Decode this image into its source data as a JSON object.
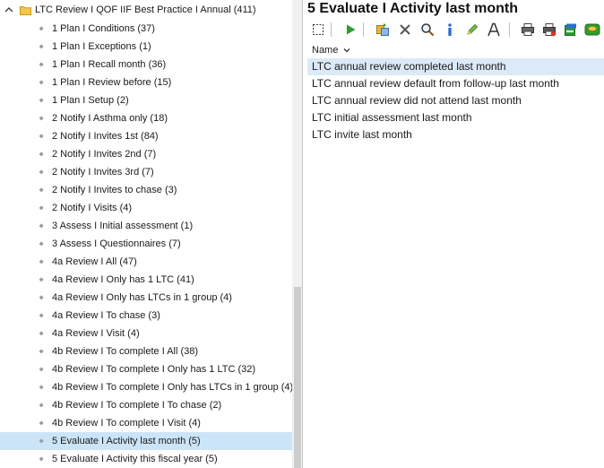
{
  "tree": {
    "root_label": "LTC Review I QOF IIF Best Practice I Annual (411)",
    "items": [
      {
        "label": "1 Plan I Conditions (37)"
      },
      {
        "label": "1 Plan I Exceptions (1)"
      },
      {
        "label": "1 Plan I Recall month (36)"
      },
      {
        "label": "1 Plan I Review before (15)"
      },
      {
        "label": "1 Plan I Setup (2)"
      },
      {
        "label": "2 Notify I Asthma only (18)"
      },
      {
        "label": "2 Notify I Invites 1st (84)"
      },
      {
        "label": "2 Notify I Invites 2nd (7)"
      },
      {
        "label": "2 Notify I Invites 3rd (7)"
      },
      {
        "label": "2 Notify I Invites to chase (3)"
      },
      {
        "label": "2 Notify I Visits (4)"
      },
      {
        "label": "3 Assess I Initial assessment (1)"
      },
      {
        "label": "3 Assess I Questionnaires (7)"
      },
      {
        "label": "4a Review I All (47)"
      },
      {
        "label": "4a Review I Only has 1 LTC (41)"
      },
      {
        "label": "4a Review I Only has LTCs in 1 group (4)"
      },
      {
        "label": "4a Review I To chase (3)"
      },
      {
        "label": "4a Review I Visit (4)"
      },
      {
        "label": "4b Review I To complete I All (38)"
      },
      {
        "label": "4b Review I To complete I Only has 1 LTC (32)"
      },
      {
        "label": "4b Review I To complete I Only has LTCs in 1 group (4)"
      },
      {
        "label": "4b Review I To complete I To chase (2)"
      },
      {
        "label": "4b Review I To complete I Visit (4)"
      },
      {
        "label": "5 Evaluate I Activity last month (5)"
      },
      {
        "label": "5 Evaluate I Activity this fiscal year (5)"
      }
    ],
    "selected_index": 23
  },
  "main": {
    "title": "5 Evaluate I Activity last month",
    "column_header": "Name",
    "rows": [
      {
        "name": "LTC annual review completed last month"
      },
      {
        "name": "LTC annual review default from follow-up last month"
      },
      {
        "name": "LTC annual review did not attend last month"
      },
      {
        "name": "LTC initial assessment last month"
      },
      {
        "name": "LTC invite last month"
      }
    ],
    "selected_row": 0
  },
  "toolbar": {
    "buttons": [
      "select-icon",
      "run-icon",
      "copy-icon",
      "delete-icon",
      "search-icon",
      "info-icon",
      "edit-icon",
      "font-icon",
      "print-icon",
      "print-red-icon",
      "export-icon",
      "database-icon"
    ]
  },
  "colors": {
    "selection": "#cce4f7",
    "row_selection": "#dce9f7",
    "run_green": "#2e9e2e",
    "info_blue": "#2a6fd1"
  }
}
